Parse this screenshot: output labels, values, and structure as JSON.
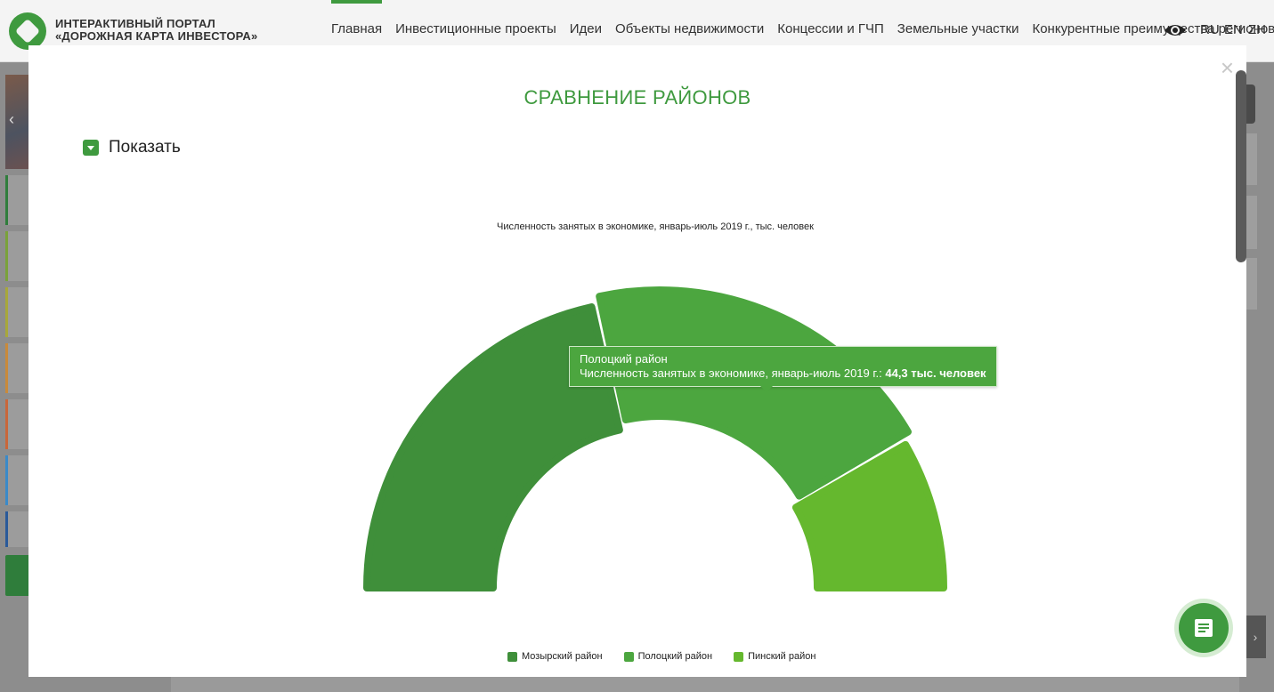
{
  "header": {
    "logo_line1": "ИНТЕРАКТИВНЫЙ ПОРТАЛ",
    "logo_line2": "«ДОРОЖНАЯ КАРТА ИНВЕСТОРА»",
    "nav": [
      {
        "label": "Главная"
      },
      {
        "label": "Инвестиционные проекты"
      },
      {
        "label": "Идеи"
      },
      {
        "label": "Объекты недвижимости"
      },
      {
        "label": "Концессии и ГЧП"
      },
      {
        "label": "Земельные участки"
      },
      {
        "label": "Конкурентные преимущества регионов"
      }
    ],
    "languages": [
      "RU",
      "EN",
      "ZH"
    ]
  },
  "modal": {
    "title": "СРАВНЕНИЕ РАЙОНОВ",
    "close_symbol": "×",
    "show_label": "Показать"
  },
  "tooltip": {
    "district": "Полоцкий район",
    "metric": "Численность занятых в экономике, январь-июль 2019 г.: ",
    "value_text": "44,3 тыс. человек"
  },
  "chart_data": {
    "type": "pie",
    "variant": "semi-donut",
    "title": "Численность занятых в экономике, январь-июль 2019 г., тыс. человек",
    "unit": "тыс. человек",
    "series": [
      {
        "name": "Мозырский район",
        "value": 47.6,
        "color": "#3f8f3a"
      },
      {
        "name": "Полоцкий район",
        "value": 44.3,
        "color": "#4ca63f"
      },
      {
        "name": "Пинский район",
        "value": 18.5,
        "color": "#65b82e"
      }
    ],
    "highlighted": "Полоцкий район",
    "legend_position": "bottom"
  }
}
